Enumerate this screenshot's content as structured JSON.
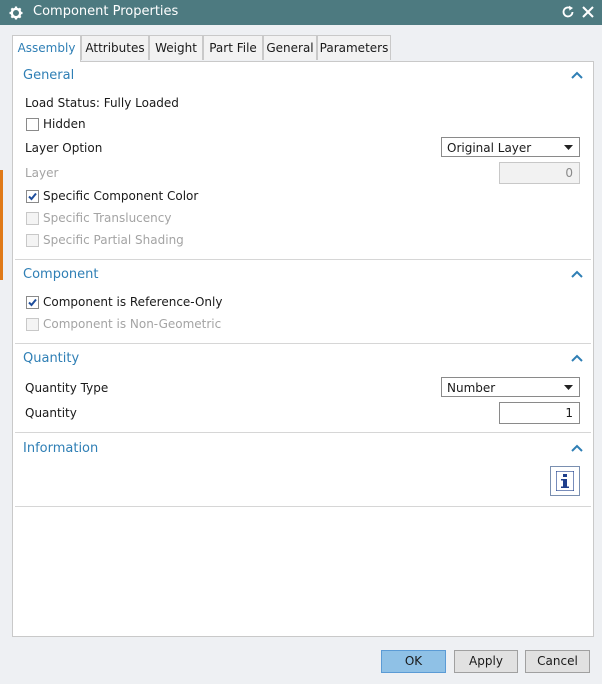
{
  "window": {
    "title": "Component Properties",
    "icon": "gear-icon"
  },
  "tabs": [
    {
      "label": "Assembly",
      "active": true
    },
    {
      "label": "Attributes"
    },
    {
      "label": "Weight"
    },
    {
      "label": "Part File"
    },
    {
      "label": "General"
    },
    {
      "label": "Parameters"
    }
  ],
  "general": {
    "heading": "General",
    "load_status": "Load Status: Fully Loaded",
    "hidden_label": "Hidden",
    "hidden_checked": false,
    "layer_option_label": "Layer Option",
    "layer_option_value": "Original Layer",
    "layer_label": "Layer",
    "layer_value": "0",
    "specific_color_label": "Specific Component Color",
    "specific_color_checked": true,
    "translucency_label": "Specific Translucency",
    "partial_shading_label": "Specific Partial Shading"
  },
  "component": {
    "heading": "Component",
    "ref_only_label": "Component is Reference-Only",
    "ref_only_checked": true,
    "non_geometric_label": "Component is Non-Geometric"
  },
  "quantity": {
    "heading": "Quantity",
    "type_label": "Quantity Type",
    "type_value": "Number",
    "quantity_label": "Quantity",
    "quantity_value": "1"
  },
  "information": {
    "heading": "Information",
    "button_icon": "info-icon"
  },
  "buttons": {
    "ok": "OK",
    "apply": "Apply",
    "cancel": "Cancel"
  },
  "colors": {
    "titlebar": "#4d7a80",
    "accent": "#2f7fb5",
    "primary_button": "#8fc1e6"
  }
}
